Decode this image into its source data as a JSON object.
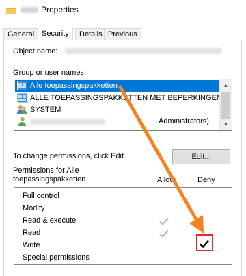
{
  "window": {
    "title": "Properties",
    "folder_icon": "folder-icon"
  },
  "tabs": [
    {
      "label": "General",
      "active": false
    },
    {
      "label": "Security",
      "active": true
    },
    {
      "label": "Details",
      "active": false
    },
    {
      "label": "Previous Versions",
      "active": false
    }
  ],
  "object_name_label": "Object name:",
  "group_label": "Group or user names:",
  "users": [
    {
      "label": "Alle toepassingspakketten",
      "icon": "app-package-icon",
      "selected": true
    },
    {
      "label": "ALLE TOEPASSINGSPAKKETTEN MET BEPERKINGEN",
      "icon": "app-package-icon",
      "selected": false
    },
    {
      "label": "SYSTEM",
      "icon": "users-icon",
      "selected": false
    },
    {
      "label": "",
      "icon": "user-icon",
      "selected": false
    },
    {
      "label": "Administrators)",
      "icon": "users-icon",
      "selected": false
    }
  ],
  "change_text": "To change permissions, click Edit.",
  "edit_label": "Edit...",
  "permissions_for": "Permissions for Alle",
  "permissions_for_2": "toepassingspakketten",
  "allow_label": "Allow",
  "deny_label": "Deny",
  "permissions": [
    {
      "name": "Full control",
      "allow": false,
      "deny": false
    },
    {
      "name": "Modify",
      "allow": false,
      "deny": false
    },
    {
      "name": "Read & execute",
      "allow": true,
      "deny": false
    },
    {
      "name": "Read",
      "allow": true,
      "deny": false
    },
    {
      "name": "Write",
      "allow": false,
      "deny": true
    },
    {
      "name": "Special permissions",
      "allow": false,
      "deny": false
    }
  ],
  "colors": {
    "selection": "#0078d7",
    "arrow": "#f5821f",
    "highlight": "#e2292e",
    "allow_check": "#b5b5b5"
  }
}
